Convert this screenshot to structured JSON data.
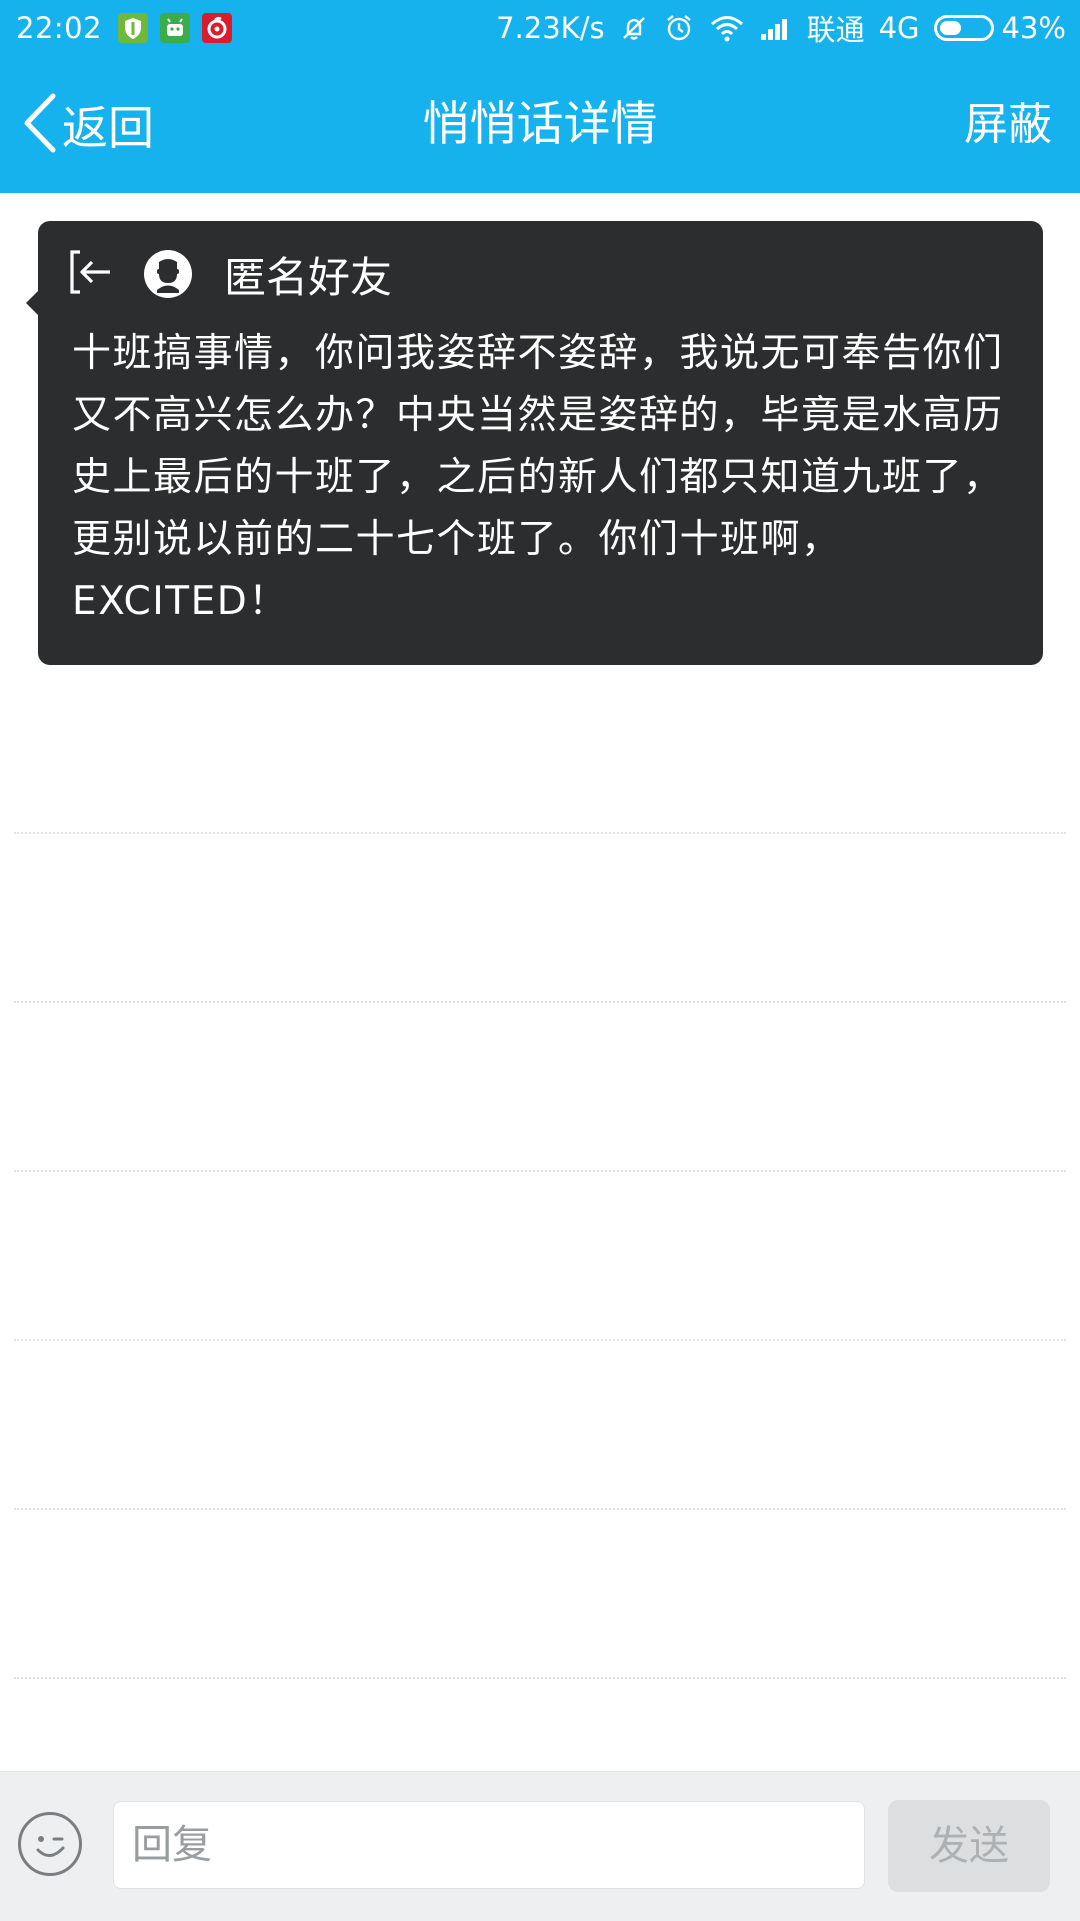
{
  "status_bar": {
    "time": "22:02",
    "app_icons": [
      {
        "name": "shield-app-icon",
        "color": "#6fb83c"
      },
      {
        "name": "android-app-icon",
        "color": "#3cab4a"
      },
      {
        "name": "netease-music-icon",
        "color": "#d81e2c"
      }
    ],
    "net_speed": "7.23K/s",
    "carrier": "联通",
    "network_type": "4G",
    "battery_percent": "43%",
    "battery_level": 0.43
  },
  "header": {
    "back_label": "返回",
    "title": "悄悄话详情",
    "block_label": "屏蔽",
    "background_color": "#16b2ee"
  },
  "message": {
    "sender_name": "匿名好友",
    "text": "十班搞事情，你问我姿辞不姿辞，我说无可奉告你们又不高兴怎么办？中央当然是姿辞的，毕竟是水高历史上最后的十班了，之后的新人们都只知道九班了，更别说以前的二十七个班了。你们十班啊，EXCITED！",
    "bubble_color": "#2b2d2e"
  },
  "input_bar": {
    "placeholder": "回复",
    "value": "",
    "send_label": "发送"
  }
}
